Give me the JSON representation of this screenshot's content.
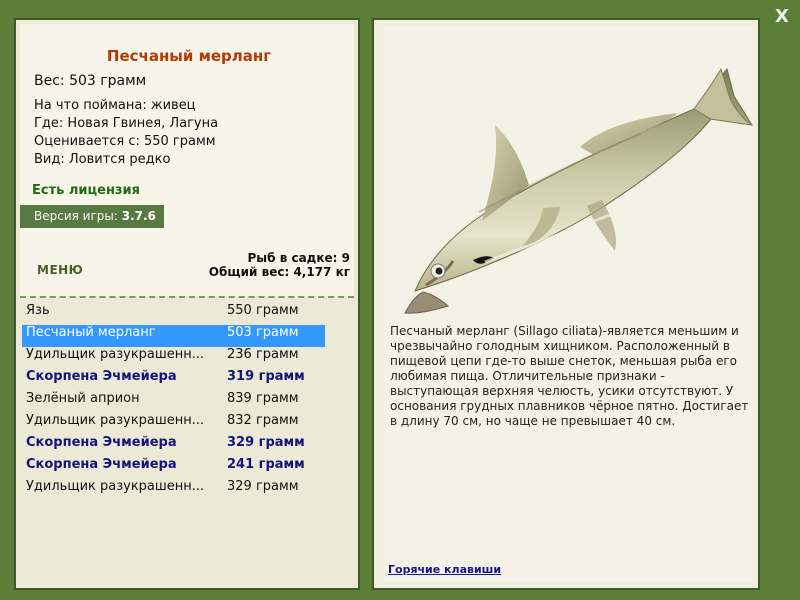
{
  "app": {
    "close_label": "X"
  },
  "fish_card": {
    "title": "Песчаный мерланг",
    "weight": "Вес: 503 грамм",
    "caught_with": "На что поймана: живец",
    "location": "Где: Новая Гвинея, Лагуна",
    "value_from": "Оценивается с: 550 грамм",
    "rarity": "Вид: Ловится редко",
    "license": "Есть лицензия",
    "version_label": "Версия игры:",
    "version_value": "3.7.6"
  },
  "menu": {
    "label": "МЕНЮ"
  },
  "stats": {
    "fish_in_keepnet": "Рыб в садке: 9",
    "total_weight": "Общий вес: 4,177 кг"
  },
  "catch_list": [
    {
      "name": "Язь",
      "weight": "550 грамм",
      "selected": false,
      "rare": false
    },
    {
      "name": "Песчаный мерланг",
      "weight": "503 грамм",
      "selected": true,
      "rare": false
    },
    {
      "name": "Удильщик разукрашенн...",
      "weight": "236 грамм",
      "selected": false,
      "rare": false
    },
    {
      "name": "Скорпена Эчмейера",
      "weight": "319 грамм",
      "selected": false,
      "rare": true
    },
    {
      "name": "Зелёный априон",
      "weight": "839 грамм",
      "selected": false,
      "rare": false
    },
    {
      "name": "Удильщик разукрашенн...",
      "weight": "832 грамм",
      "selected": false,
      "rare": false
    },
    {
      "name": "Скорпена Эчмейера",
      "weight": "329 грамм",
      "selected": false,
      "rare": true
    },
    {
      "name": "Скорпена Эчмейера",
      "weight": "241 грамм",
      "selected": false,
      "rare": true
    },
    {
      "name": "Удильщик разукрашенн...",
      "weight": "329 грамм",
      "selected": false,
      "rare": false
    }
  ],
  "description": {
    "text": "Песчаный мерланг (Sillago ciliata)-является меньшим и чрезвычайно голодным хищником. Расположенный в пищевой цепи где-то выше снеток, меньшая рыба его любимая пища. Отличительные признаки - выступающая верхняя челюсть, усики отсутствуют. У основания грудных плавников чёрное пятно. Достигает в длину 70 см, но чаще не превышает 40 см."
  },
  "footer": {
    "hotkeys": "Горячие клавиши"
  },
  "icons": {
    "fish_picture": "sand-whiting-fish-image",
    "close": "close-icon"
  },
  "colors": {
    "frame": "#5b7f38",
    "title": "#b33a05",
    "license": "#1f6b10",
    "selected": "#3399ff",
    "rare_text": "#14147a"
  }
}
